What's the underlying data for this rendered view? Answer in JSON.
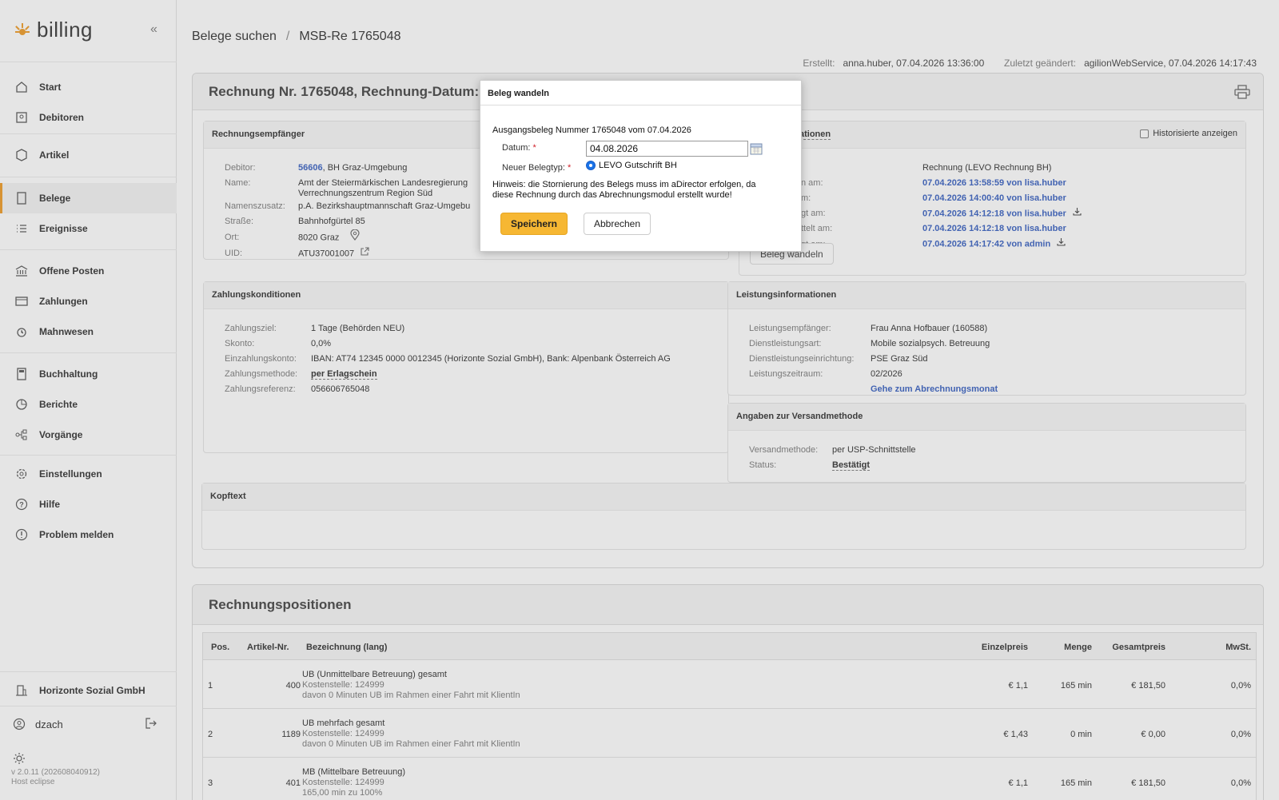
{
  "app": {
    "name": "billing"
  },
  "sidebar": {
    "items": [
      {
        "label": "Start"
      },
      {
        "label": "Debitoren"
      },
      {
        "label": "Artikel"
      },
      {
        "label": "Belege"
      },
      {
        "label": "Ereignisse"
      },
      {
        "label": "Offene Posten"
      },
      {
        "label": "Zahlungen"
      },
      {
        "label": "Mahnwesen"
      },
      {
        "label": "Buchhaltung"
      },
      {
        "label": "Berichte"
      },
      {
        "label": "Vorgänge"
      },
      {
        "label": "Einstellungen"
      },
      {
        "label": "Hilfe"
      },
      {
        "label": "Problem melden"
      }
    ],
    "company": "Horizonte Sozial GmbH",
    "user": "dzach",
    "version": "v 2.0.11 (202608040912)",
    "host": "Host eclipse",
    "accent": "#f0a43a"
  },
  "breadcrumb": {
    "parent": "Belege suchen",
    "separator": "/",
    "current": "MSB-Re 1765048"
  },
  "meta": {
    "created_label": "Erstellt:",
    "created_value": "anna.huber, 07.04.2026 13:36:00",
    "changed_label": "Zuletzt geändert:",
    "changed_value": "agilionWebService, 07.04.2026 14:17:43"
  },
  "invoice": {
    "title": "Rechnung Nr. 1765048, Rechnung-Datum: 07.0",
    "recipient": {
      "title": "Rechnungsempfänger",
      "debitor_label": "Debitor:",
      "debitor_id": "56606",
      "debitor_rest": ", BH Graz-Umgebung",
      "name_label": "Name:",
      "name_line1": "Amt der Steiermärkischen Landesregierung",
      "name_line2": "Verrechnungszentrum Region Süd",
      "namenszusatz_label": "Namenszusatz:",
      "namenszusatz": "p.A. Bezirkshauptmannschaft Graz-Umgebu",
      "strasse_label": "Straße:",
      "strasse": "Bahnhofgürtel 85",
      "ort_label": "Ort:",
      "ort": "8020 Graz",
      "uid_label": "UID:",
      "uid": "ATU37001007"
    },
    "status": {
      "title_fragment": "ationen",
      "historized_label": "Historisierte anzeigen",
      "type_value": "Rechnung (LEVO Rechnung BH)",
      "rows": [
        {
          "label": "n am:",
          "value": "07.04.2026 13:58:59 von lisa.huber"
        },
        {
          "label": "m:",
          "value": "07.04.2026 14:00:40 von lisa.huber"
        },
        {
          "label": "gt am:",
          "value": "07.04.2026 14:12:18 von lisa.huber"
        },
        {
          "label": "ttelt am:",
          "value": "07.04.2026 14:12:18 von lisa.huber"
        },
        {
          "label": "gt am:",
          "value": "07.04.2026 14:17:42 von admin"
        }
      ],
      "convert_button": "Beleg wandeln"
    },
    "payment": {
      "title": "Zahlungskonditionen",
      "rows": [
        {
          "label": "Zahlungsziel:",
          "value": "1 Tage (Behörden NEU)"
        },
        {
          "label": "Skonto:",
          "value": "0,0%"
        },
        {
          "label": "Einzahlungskonto:",
          "value": "IBAN: AT74 12345 0000 0012345 (Horizonte Sozial GmbH), Bank: Alpenbank Österreich AG"
        },
        {
          "label": "Zahlungsmethode:",
          "value": "per Erlagschein"
        },
        {
          "label": "Zahlungsreferenz:",
          "value": "056606765048"
        }
      ]
    },
    "service": {
      "title": "Leistungsinformationen",
      "rows": [
        {
          "label": "Leistungsempfänger:",
          "value": "Frau Anna Hofbauer (160588)"
        },
        {
          "label": "Dienstleistungsart:",
          "value": "Mobile sozialpsych. Betreuung"
        },
        {
          "label": "Dienstleistungseinrichtung:",
          "value": "PSE Graz Süd"
        },
        {
          "label": "Leistungszeitraum:",
          "value": "02/2026"
        }
      ],
      "link": "Gehe zum Abrechnungsmonat"
    },
    "shipping": {
      "title": "Angaben zur Versandmethode",
      "method_label": "Versandmethode:",
      "method_value": "per USP-Schnittstelle",
      "status_label": "Status:",
      "status_value": "Bestätigt"
    },
    "header_text": {
      "title": "Kopftext"
    }
  },
  "positions": {
    "title": "Rechnungspositionen",
    "columns": [
      "Pos.",
      "Artikel-Nr.",
      "Bezeichnung (lang)",
      "Einzelpreis",
      "Menge",
      "Gesamtpreis",
      "MwSt."
    ],
    "rows": [
      {
        "pos": "1",
        "article": "400",
        "name": "UB (Unmittelbare Betreuung) gesamt",
        "cost": "Kostenstelle: 124999",
        "note": "davon 0 Minuten UB im Rahmen einer Fahrt mit KlientIn",
        "unit": "€ 1,1",
        "qty": "165 min",
        "total": "€ 181,50",
        "vat": "0,0%"
      },
      {
        "pos": "2",
        "article": "1189",
        "name": "UB mehrfach gesamt",
        "cost": "Kostenstelle: 124999",
        "note": "davon 0 Minuten UB im Rahmen einer Fahrt mit KlientIn",
        "unit": "€ 1,43",
        "qty": "0 min",
        "total": "€ 0,00",
        "vat": "0,0%"
      },
      {
        "pos": "3",
        "article": "401",
        "name": "MB (Mittelbare Betreuung)",
        "cost": "Kostenstelle: 124999",
        "note": "165,00 min zu 100%",
        "unit": "€ 1,1",
        "qty": "165 min",
        "total": "€ 181,50",
        "vat": "0,0%"
      }
    ]
  },
  "modal": {
    "title": "Beleg wandeln",
    "subtitle": "Ausgangsbeleg Nummer 1765048 vom 07.04.2026",
    "date_label": "Datum:",
    "date_value": "04.08.2026",
    "type_label": "Neuer Belegtyp:",
    "type_option": "LEVO Gutschrift BH",
    "required_mark": "*",
    "hint_line1": "Hinweis: die Stornierung des Belegs muss im aDirector erfolgen, da",
    "hint_line2": "diese Rechnung durch das Abrechnungsmodul erstellt wurde!",
    "save": "Speichern",
    "cancel": "Abbrechen"
  }
}
